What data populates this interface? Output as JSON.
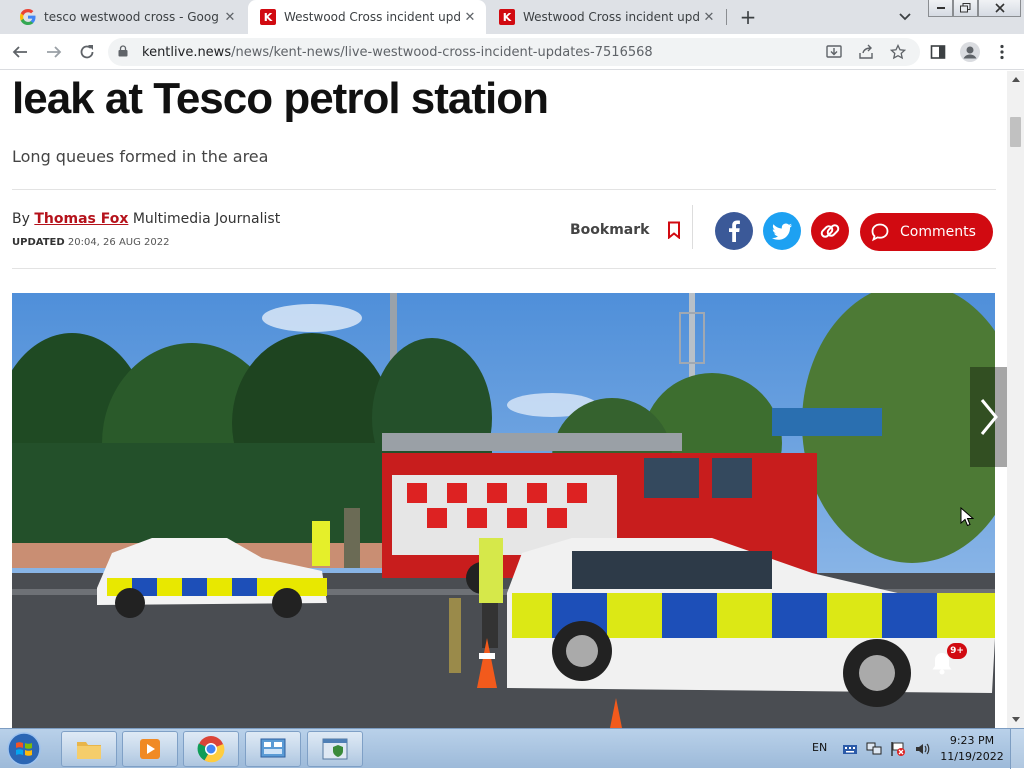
{
  "browser": {
    "tabs": [
      {
        "title": "tesco westwood cross - Google S",
        "favicon": "google-icon",
        "active": false
      },
      {
        "title": "Westwood Cross incident update",
        "favicon": "kentlive-icon",
        "active": true
      },
      {
        "title": "Westwood Cross incident update",
        "favicon": "kentlive-icon",
        "active": false
      }
    ],
    "favicon_letter": "K",
    "new_tab_label": "+",
    "url_host": "kentlive.news",
    "url_path": "/news/kent-news/live-westwood-cross-incident-updates-7516568"
  },
  "article": {
    "headline": "leak at Tesco petrol station",
    "standfirst": "Long queues formed in the area",
    "byline_prefix": "By",
    "author": "Thomas Fox",
    "author_role": "Multimedia Journalist",
    "updated_label": "UPDATED",
    "updated_time": "20:04, 26 AUG 2022",
    "bookmark_label": "Bookmark",
    "comments_label": "Comments",
    "notification_badge": "9+"
  },
  "share": [
    {
      "network": "facebook",
      "color": "#3b5998",
      "glyph": "f"
    },
    {
      "network": "twitter",
      "color": "#1da1f2"
    },
    {
      "network": "copy-link",
      "color": "#d10a11"
    }
  ],
  "colors": {
    "brand_red": "#d10a11",
    "author_red": "#b5121b"
  },
  "taskbar": {
    "language": "EN",
    "time": "9:23 PM",
    "date": "11/19/2022"
  }
}
